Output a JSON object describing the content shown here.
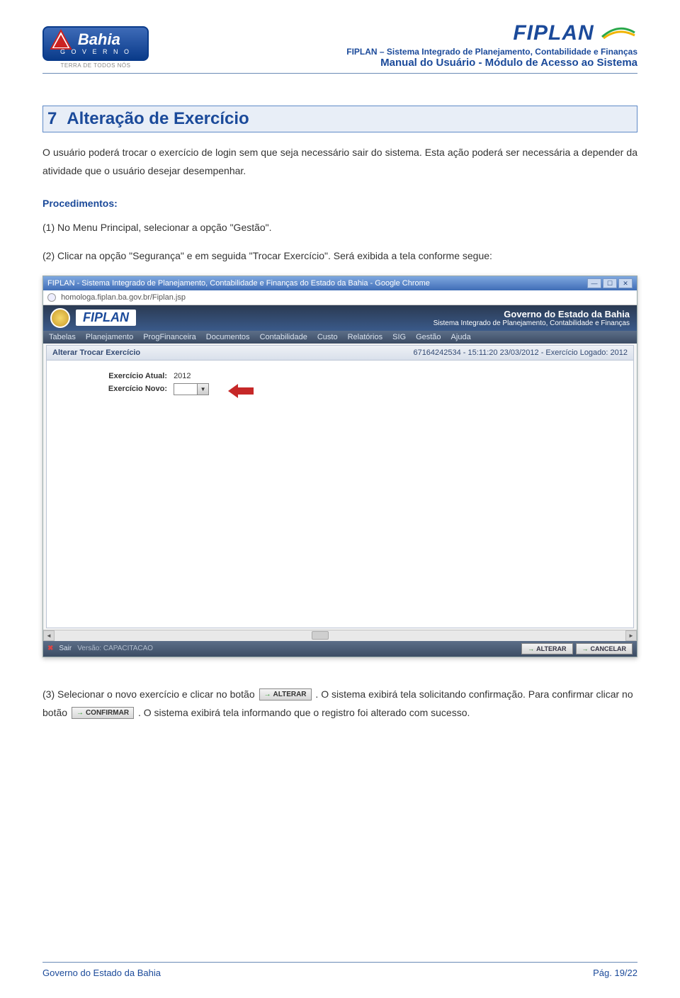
{
  "header": {
    "bahia_name": "Bahia",
    "bahia_sub": "G O V E R N O",
    "bahia_tag": "TERRA DE TODOS NÓS",
    "fiplan_logo": "FIPLAN",
    "line1": "FIPLAN – Sistema Integrado de Planejamento, Contabilidade e Finanças",
    "line2": "Manual do Usuário - Módulo de Acesso ao Sistema"
  },
  "section": {
    "number": "7",
    "title": "Alteração de Exercício"
  },
  "intro": "O usuário poderá trocar o exercício de login sem que seja necessário sair do sistema. Esta ação poderá ser necessária a depender da atividade que o usuário desejar desempenhar.",
  "proc_heading": "Procedimentos:",
  "steps": {
    "s1": "(1) No Menu Principal, selecionar a opção \"Gestão\".",
    "s2": "(2) Clicar na opção \"Segurança\" e em seguida \"Trocar Exercício\". Será exibida a tela conforme segue:",
    "s3_a": "(3) Selecionar o novo exercício e clicar no botão ",
    "s3_b": ". O sistema exibirá tela solicitando confirmação. Para confirmar clicar no botão ",
    "s3_c": ". O sistema exibirá tela informando que o registro foi alterado com sucesso."
  },
  "buttons": {
    "alterar": "ALTERAR",
    "confirmar": "CONFIRMAR",
    "cancelar": "CANCELAR",
    "sair": "Sair"
  },
  "screenshot": {
    "window_title": "FIPLAN - Sistema Integrado de Planejamento, Contabilidade e Finanças do Estado da Bahia - Google Chrome",
    "url": "homologa.fiplan.ba.gov.br/Fiplan.jsp",
    "app_logo": "FIPLAN",
    "gov_title": "Governo do Estado da Bahia",
    "gov_sub": "Sistema Integrado de Planejamento, Contabilidade e Finanças",
    "menu": [
      "Tabelas",
      "Planejamento",
      "ProgFinanceira",
      "Documentos",
      "Contabilidade",
      "Custo",
      "Relatórios",
      "SIG",
      "Gestão",
      "Ajuda"
    ],
    "panel_title": "Alterar Trocar Exercício",
    "panel_status": "67164242534 - 15:11:20 23/03/2012 - Exercício Logado: 2012",
    "field1_label": "Exercício Atual:",
    "field1_value": "2012",
    "field2_label": "Exercício Novo:",
    "footer_version": "Versão: CAPACITACAO"
  },
  "footer": {
    "left": "Governo do Estado da Bahia",
    "right": "Pág. 19/22"
  }
}
